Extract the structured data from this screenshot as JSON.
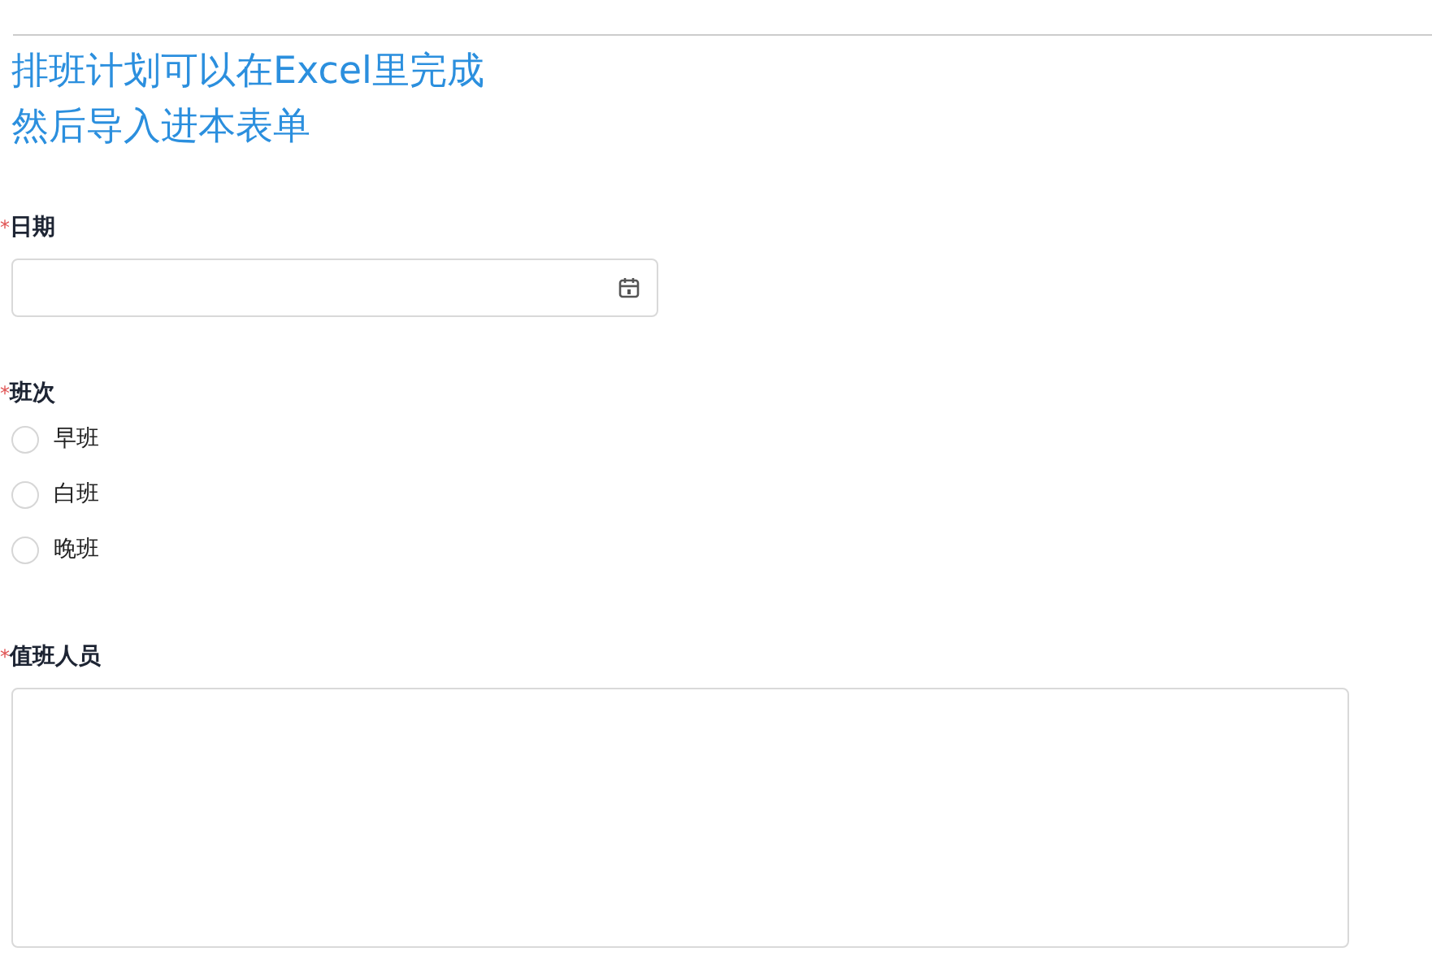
{
  "heading": [
    "排班计划可以在Excel里完成",
    "然后导入进本表单"
  ],
  "fields": [
    {
      "kind": "date",
      "label": "日期",
      "required": true,
      "required_mark": "*"
    },
    {
      "kind": "radio",
      "label": "班次",
      "required": true,
      "required_mark": "*",
      "options": [
        {
          "label": "早班",
          "selected": false
        },
        {
          "label": "白班",
          "selected": false
        },
        {
          "label": "晚班",
          "selected": false
        }
      ]
    },
    {
      "kind": "textarea",
      "label": "值班人员",
      "required": true,
      "required_mark": "*"
    }
  ]
}
